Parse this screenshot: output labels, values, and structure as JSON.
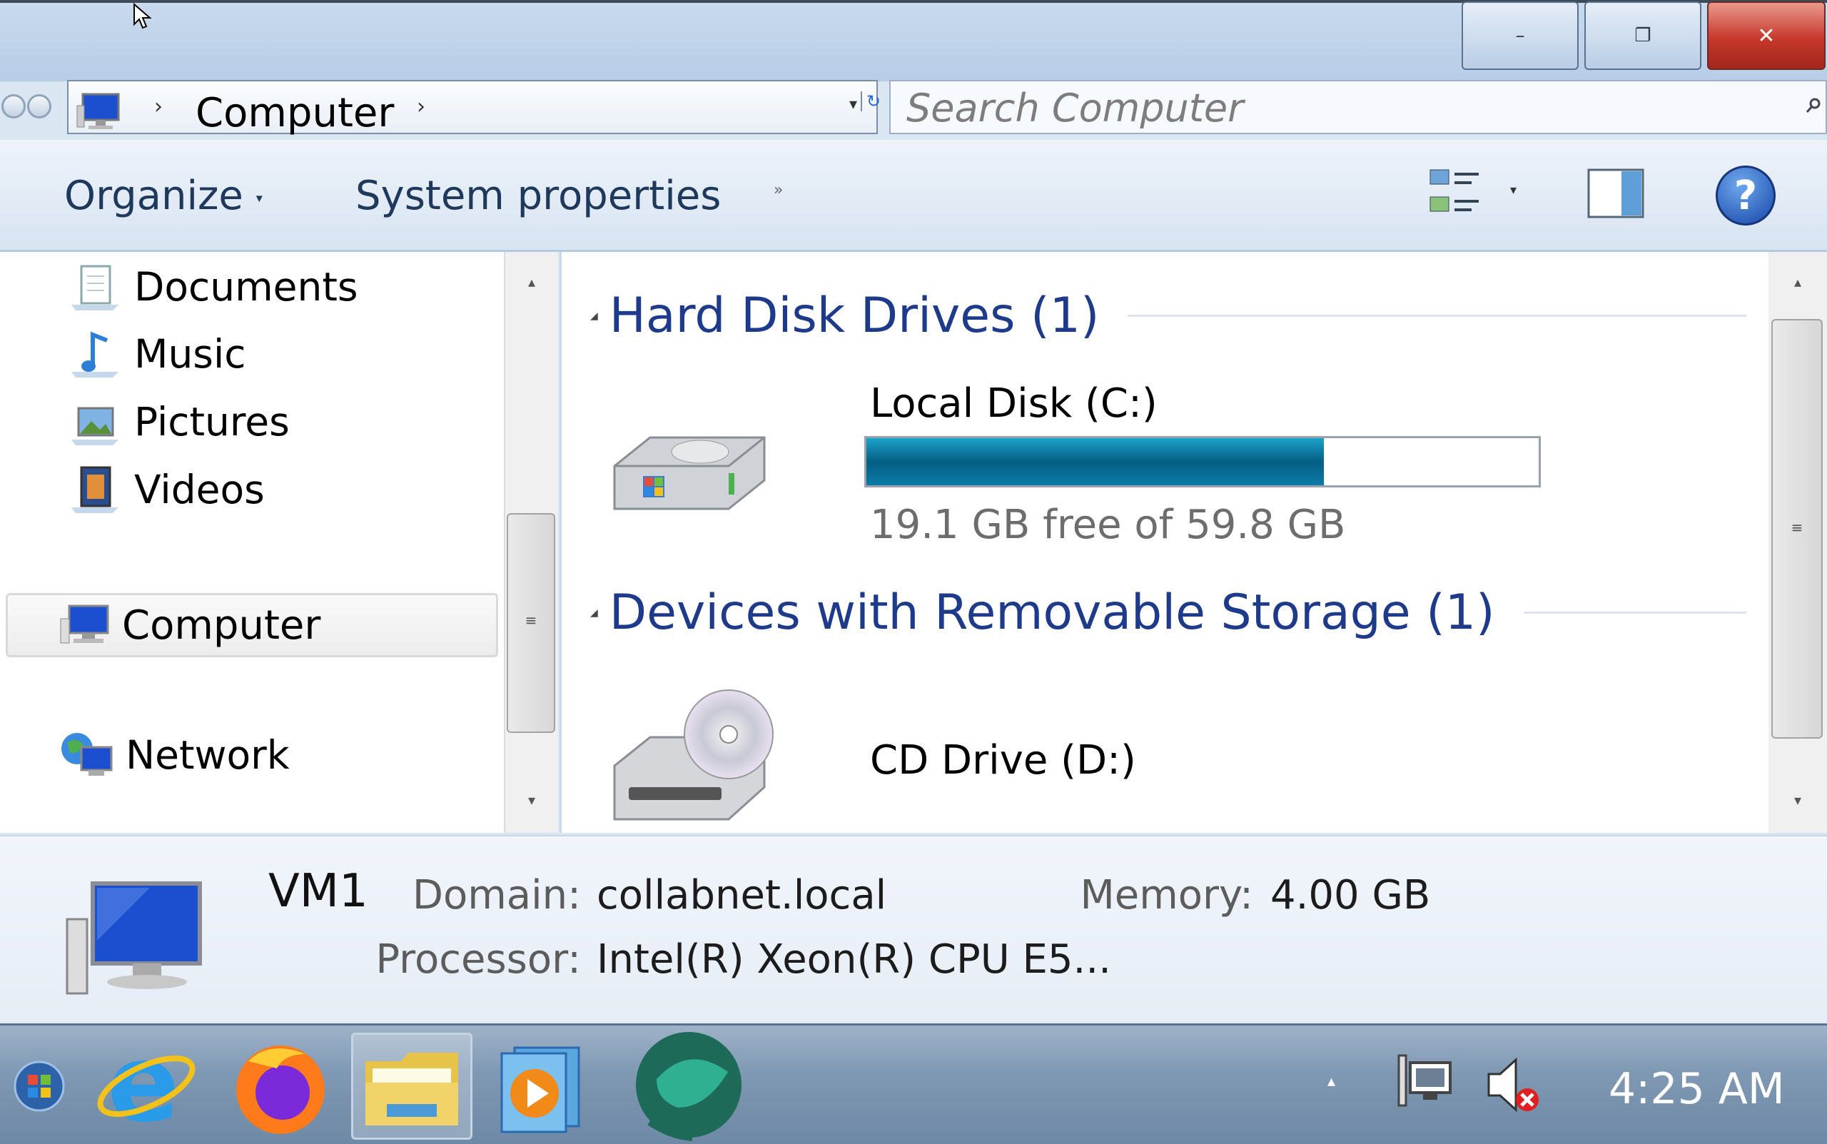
{
  "window": {
    "minimize_label": "–",
    "restore_label": "❐",
    "close_label": "✕"
  },
  "address": {
    "location": "Computer",
    "separator": "›",
    "dropdown": "▾",
    "refresh": "↻"
  },
  "search": {
    "placeholder": "Search Computer",
    "icon": "search-icon"
  },
  "command_bar": {
    "organize_label": "Organize",
    "organize_arrow": "▾",
    "system_properties_label": "System properties",
    "more_arrow": "»",
    "views_arrow": "▾",
    "help_label": "?"
  },
  "nav_pane": {
    "items": [
      {
        "label": "Documents",
        "icon": "documents-icon"
      },
      {
        "label": "Music",
        "icon": "music-icon"
      },
      {
        "label": "Pictures",
        "icon": "pictures-icon"
      },
      {
        "label": "Videos",
        "icon": "videos-icon"
      }
    ],
    "computer_label": "Computer",
    "network_label": "Network",
    "scroll_up": "▴",
    "scroll_down": "▾",
    "grip": "≡"
  },
  "content": {
    "groups": [
      {
        "title": "Hard Disk Drives (1)",
        "toggle": "◢"
      },
      {
        "title": "Devices with Removable Storage (1)",
        "toggle": "◢"
      }
    ],
    "local_disk": {
      "name": "Local Disk (C:)",
      "free_text": "19.1 GB free of 59.8 GB",
      "used_fraction": 0.68
    },
    "cd_drive": {
      "name": "CD Drive (D:)"
    },
    "scroll_up": "▴",
    "scroll_down": "▾",
    "grip": "≡"
  },
  "details": {
    "computer_name": "VM1",
    "domain_label": "Domain:",
    "domain_value": "collabnet.local",
    "memory_label": "Memory:",
    "memory_value": "4.00 GB",
    "processor_label": "Processor:",
    "processor_value": "Intel(R) Xeon(R) CPU E5..."
  },
  "taskbar": {
    "apps": [
      "start-orb",
      "internet-explorer",
      "firefox",
      "windows-explorer",
      "media-player",
      "app-orb"
    ],
    "tray_arrow": "▴",
    "clock": "4:25 AM"
  },
  "colors": {
    "group_header": "#1e3a8a",
    "progress_fill": "#0f7fa8",
    "close_button": "#c6382b"
  }
}
